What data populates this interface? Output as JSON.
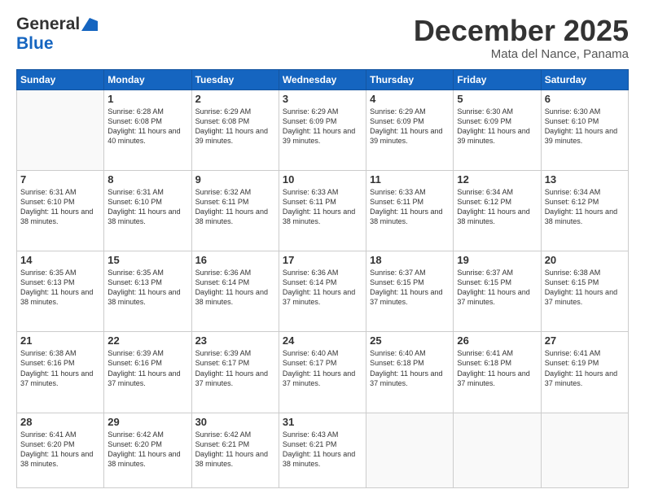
{
  "header": {
    "logo_line1": "General",
    "logo_line2": "Blue",
    "month": "December 2025",
    "location": "Mata del Nance, Panama"
  },
  "weekdays": [
    "Sunday",
    "Monday",
    "Tuesday",
    "Wednesday",
    "Thursday",
    "Friday",
    "Saturday"
  ],
  "weeks": [
    [
      {
        "day": "",
        "empty": true
      },
      {
        "day": "1",
        "sunrise": "6:28 AM",
        "sunset": "6:08 PM",
        "daylight": "11 hours and 40 minutes."
      },
      {
        "day": "2",
        "sunrise": "6:29 AM",
        "sunset": "6:08 PM",
        "daylight": "11 hours and 39 minutes."
      },
      {
        "day": "3",
        "sunrise": "6:29 AM",
        "sunset": "6:09 PM",
        "daylight": "11 hours and 39 minutes."
      },
      {
        "day": "4",
        "sunrise": "6:29 AM",
        "sunset": "6:09 PM",
        "daylight": "11 hours and 39 minutes."
      },
      {
        "day": "5",
        "sunrise": "6:30 AM",
        "sunset": "6:09 PM",
        "daylight": "11 hours and 39 minutes."
      },
      {
        "day": "6",
        "sunrise": "6:30 AM",
        "sunset": "6:10 PM",
        "daylight": "11 hours and 39 minutes."
      }
    ],
    [
      {
        "day": "7",
        "sunrise": "6:31 AM",
        "sunset": "6:10 PM",
        "daylight": "11 hours and 38 minutes."
      },
      {
        "day": "8",
        "sunrise": "6:31 AM",
        "sunset": "6:10 PM",
        "daylight": "11 hours and 38 minutes."
      },
      {
        "day": "9",
        "sunrise": "6:32 AM",
        "sunset": "6:11 PM",
        "daylight": "11 hours and 38 minutes."
      },
      {
        "day": "10",
        "sunrise": "6:33 AM",
        "sunset": "6:11 PM",
        "daylight": "11 hours and 38 minutes."
      },
      {
        "day": "11",
        "sunrise": "6:33 AM",
        "sunset": "6:11 PM",
        "daylight": "11 hours and 38 minutes."
      },
      {
        "day": "12",
        "sunrise": "6:34 AM",
        "sunset": "6:12 PM",
        "daylight": "11 hours and 38 minutes."
      },
      {
        "day": "13",
        "sunrise": "6:34 AM",
        "sunset": "6:12 PM",
        "daylight": "11 hours and 38 minutes."
      }
    ],
    [
      {
        "day": "14",
        "sunrise": "6:35 AM",
        "sunset": "6:13 PM",
        "daylight": "11 hours and 38 minutes."
      },
      {
        "day": "15",
        "sunrise": "6:35 AM",
        "sunset": "6:13 PM",
        "daylight": "11 hours and 38 minutes."
      },
      {
        "day": "16",
        "sunrise": "6:36 AM",
        "sunset": "6:14 PM",
        "daylight": "11 hours and 38 minutes."
      },
      {
        "day": "17",
        "sunrise": "6:36 AM",
        "sunset": "6:14 PM",
        "daylight": "11 hours and 37 minutes."
      },
      {
        "day": "18",
        "sunrise": "6:37 AM",
        "sunset": "6:15 PM",
        "daylight": "11 hours and 37 minutes."
      },
      {
        "day": "19",
        "sunrise": "6:37 AM",
        "sunset": "6:15 PM",
        "daylight": "11 hours and 37 minutes."
      },
      {
        "day": "20",
        "sunrise": "6:38 AM",
        "sunset": "6:15 PM",
        "daylight": "11 hours and 37 minutes."
      }
    ],
    [
      {
        "day": "21",
        "sunrise": "6:38 AM",
        "sunset": "6:16 PM",
        "daylight": "11 hours and 37 minutes."
      },
      {
        "day": "22",
        "sunrise": "6:39 AM",
        "sunset": "6:16 PM",
        "daylight": "11 hours and 37 minutes."
      },
      {
        "day": "23",
        "sunrise": "6:39 AM",
        "sunset": "6:17 PM",
        "daylight": "11 hours and 37 minutes."
      },
      {
        "day": "24",
        "sunrise": "6:40 AM",
        "sunset": "6:17 PM",
        "daylight": "11 hours and 37 minutes."
      },
      {
        "day": "25",
        "sunrise": "6:40 AM",
        "sunset": "6:18 PM",
        "daylight": "11 hours and 37 minutes."
      },
      {
        "day": "26",
        "sunrise": "6:41 AM",
        "sunset": "6:18 PM",
        "daylight": "11 hours and 37 minutes."
      },
      {
        "day": "27",
        "sunrise": "6:41 AM",
        "sunset": "6:19 PM",
        "daylight": "11 hours and 37 minutes."
      }
    ],
    [
      {
        "day": "28",
        "sunrise": "6:41 AM",
        "sunset": "6:20 PM",
        "daylight": "11 hours and 38 minutes."
      },
      {
        "day": "29",
        "sunrise": "6:42 AM",
        "sunset": "6:20 PM",
        "daylight": "11 hours and 38 minutes."
      },
      {
        "day": "30",
        "sunrise": "6:42 AM",
        "sunset": "6:21 PM",
        "daylight": "11 hours and 38 minutes."
      },
      {
        "day": "31",
        "sunrise": "6:43 AM",
        "sunset": "6:21 PM",
        "daylight": "11 hours and 38 minutes."
      },
      {
        "day": "",
        "empty": true
      },
      {
        "day": "",
        "empty": true
      },
      {
        "day": "",
        "empty": true
      }
    ]
  ]
}
